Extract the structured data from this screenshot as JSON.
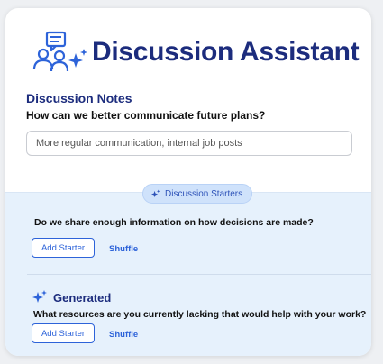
{
  "app": {
    "title": "Discussion Assistant"
  },
  "notes": {
    "section_title": "Discussion Notes",
    "question": "How can we better communicate future plans?",
    "field_value": "More regular communication, internal job posts"
  },
  "starters": {
    "chip_label": "Discussion Starters",
    "question": "Do we share enough information on how decisions are made?",
    "add_label": "Add Starter",
    "shuffle_label": "Shuffle"
  },
  "generated": {
    "label": "Generated",
    "question": "What resources are you currently lacking that would help with your work?",
    "add_label": "Add Starter",
    "shuffle_label": "Shuffle"
  },
  "colors": {
    "brand": "#1c2c7d",
    "accent": "#2d63d9",
    "panel_bg": "#e6f1fc"
  }
}
